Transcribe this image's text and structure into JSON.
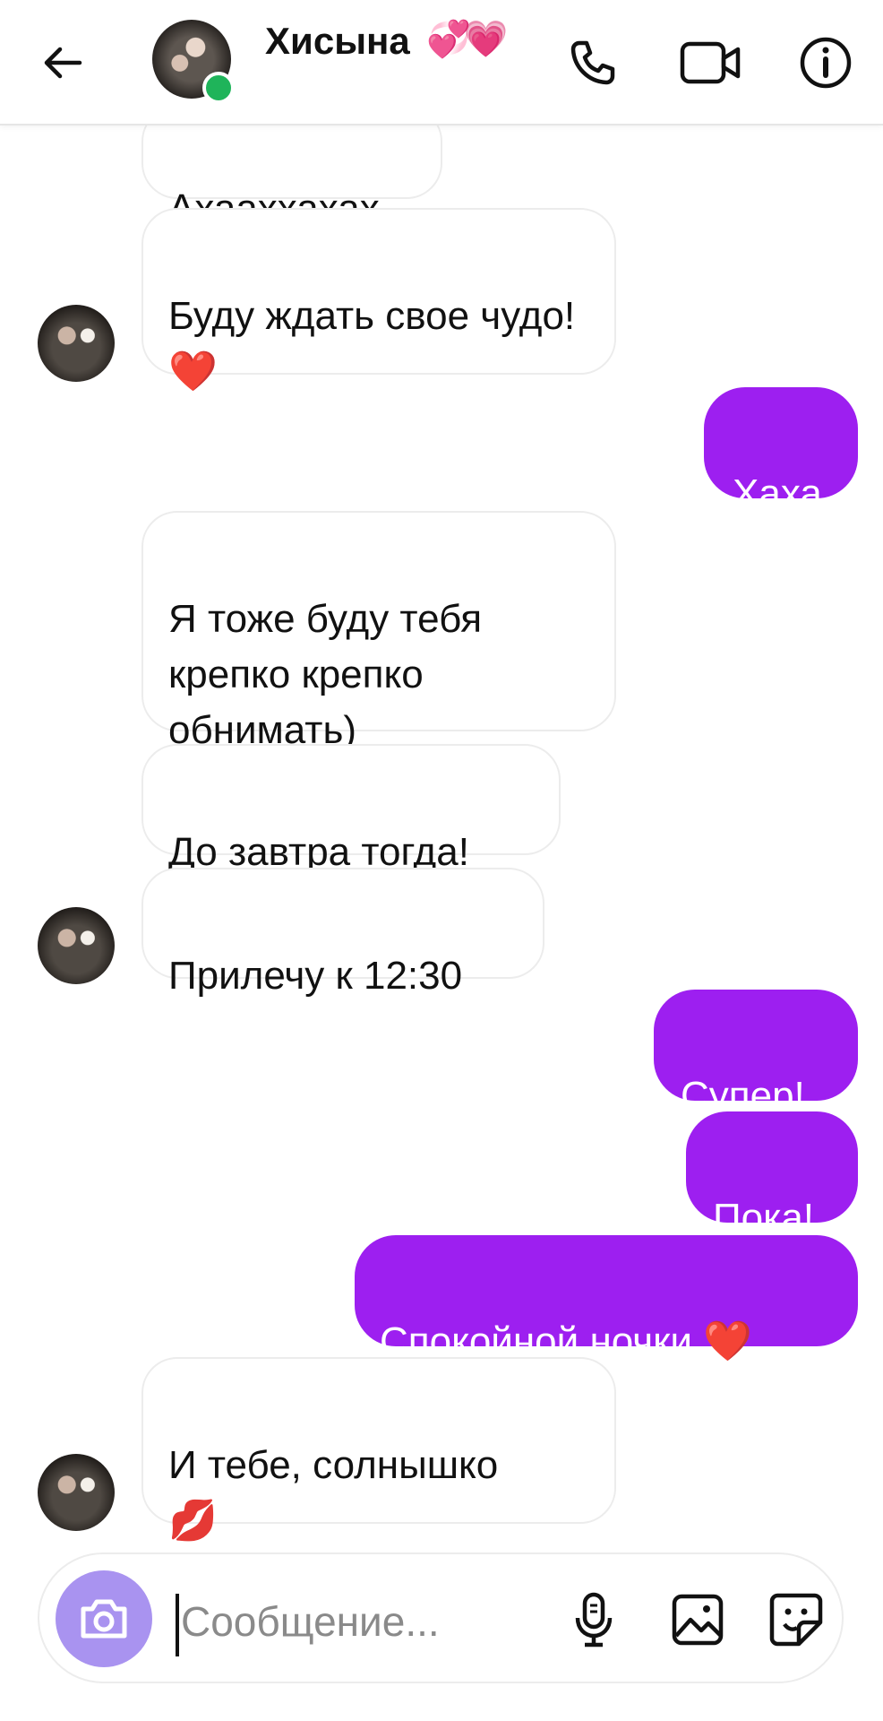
{
  "header": {
    "contact_name": "Хисына",
    "contact_emoji": "💞💗",
    "back_icon": "arrow-left-icon",
    "call_icon": "phone-icon",
    "video_icon": "video-camera-icon",
    "info_icon": "info-icon",
    "online_color": "#1fb45a"
  },
  "messages": [
    {
      "side": "in",
      "text": "Ахааххахах"
    },
    {
      "side": "in",
      "text": "Буду ждать свое чудо!",
      "emoji": "❤️"
    },
    {
      "side": "out",
      "text": "Хаха"
    },
    {
      "side": "in",
      "text": "Я тоже буду тебя крепко крепко обнимать)"
    },
    {
      "side": "in",
      "text": "До завтра тогда!"
    },
    {
      "side": "in",
      "text": "Прилечу к 12:30"
    },
    {
      "side": "out",
      "text": "Супер!"
    },
    {
      "side": "out",
      "text": "Пока!"
    },
    {
      "side": "out",
      "text": "Спокойной ночки",
      "emoji": "❤️"
    },
    {
      "side": "in",
      "text": "И тебе, солнышко",
      "emoji": "💋"
    }
  ],
  "composer": {
    "placeholder": "Сообщение...",
    "camera_icon": "camera-icon",
    "mic_icon": "microphone-icon",
    "gallery_icon": "image-icon",
    "sticker_icon": "sticker-icon"
  },
  "colors": {
    "outgoing_bubble": "#9d1ff0",
    "camera_button": "#a993f0"
  }
}
